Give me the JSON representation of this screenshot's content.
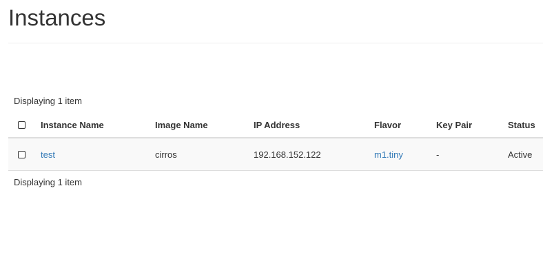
{
  "page": {
    "title": "Instances"
  },
  "table": {
    "count_top": "Displaying 1 item",
    "count_bottom": "Displaying 1 item",
    "columns": {
      "instance_name": "Instance Name",
      "image_name": "Image Name",
      "ip_address": "IP Address",
      "flavor": "Flavor",
      "key_pair": "Key Pair",
      "status": "Status"
    },
    "rows": [
      {
        "instance_name": "test",
        "image_name": "cirros",
        "ip_address": "192.168.152.122",
        "flavor": "m1.tiny",
        "key_pair": "-",
        "status": "Active"
      }
    ]
  },
  "colors": {
    "link": "#337ab7",
    "text": "#333333",
    "row_background": "#f9f9f9",
    "border": "#dddddd"
  }
}
